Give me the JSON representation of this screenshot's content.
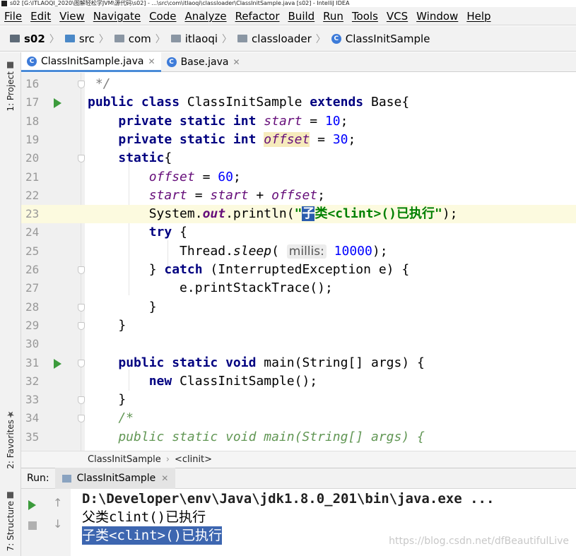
{
  "window": {
    "title": "s02 [G:\\ITLAOQI_2020\\图解轻松学JVM\\源代码\\s02] - ...\\src\\com\\itlaoqi\\classloader\\ClassInitSample.java [s02] - IntelliJ IDEA"
  },
  "menu": [
    "File",
    "Edit",
    "View",
    "Navigate",
    "Code",
    "Analyze",
    "Refactor",
    "Build",
    "Run",
    "Tools",
    "VCS",
    "Window",
    "Help"
  ],
  "breadcrumbs": [
    "s02",
    "src",
    "com",
    "itlaoqi",
    "classloader",
    "ClassInitSample"
  ],
  "left_tool_tabs": {
    "project": "1: Project",
    "favorites": "2: Favorites",
    "structure": "7: Structure"
  },
  "editor_tabs": [
    {
      "label": "ClassInitSample.java",
      "active": true
    },
    {
      "label": "Base.java",
      "active": false
    }
  ],
  "editor": {
    "lines": [
      {
        "n": "16",
        "code": " */"
      },
      {
        "n": "17",
        "code": "public class ClassInitSample extends Base{"
      },
      {
        "n": "18",
        "code": "    private static int start = 10;"
      },
      {
        "n": "19",
        "code": "    private static int offset = 30;"
      },
      {
        "n": "20",
        "code": "    static{"
      },
      {
        "n": "21",
        "code": "        offset = 60;"
      },
      {
        "n": "22",
        "code": "        start = start + offset;"
      },
      {
        "n": "23",
        "code": "        System.out.println(\"子类<clint>()已执行\");"
      },
      {
        "n": "24",
        "code": "        try {"
      },
      {
        "n": "25",
        "code": "            Thread.sleep( millis: 10000);"
      },
      {
        "n": "26",
        "code": "        } catch (InterruptedException e) {"
      },
      {
        "n": "27",
        "code": "            e.printStackTrace();"
      },
      {
        "n": "28",
        "code": "        }"
      },
      {
        "n": "29",
        "code": "    }"
      },
      {
        "n": "30",
        "code": ""
      },
      {
        "n": "31",
        "code": "    public static void main(String[] args) {"
      },
      {
        "n": "32",
        "code": "        new ClassInitSample();"
      },
      {
        "n": "33",
        "code": "    }"
      },
      {
        "n": "34",
        "code": "    /*"
      },
      {
        "n": "35",
        "code": "    public static void main(String[] args) {"
      }
    ],
    "inlay_hint": "millis:",
    "crumb": [
      "ClassInitSample",
      "<clinit>"
    ]
  },
  "run_panel": {
    "label": "Run:",
    "tab": "ClassInitSample",
    "output": [
      "D:\\Developer\\env\\Java\\jdk1.8.0_201\\bin\\java.exe ...",
      "父类clint()已执行",
      "子类<clint>()已执行"
    ]
  },
  "watermark": "https://blog.csdn.net/dfBeautifulLive",
  "colors": {
    "keyword": "#000080",
    "field": "#660e7a",
    "number": "#0000ff",
    "string": "#008000",
    "selection": "#2a5cad",
    "run_icon": "#3c9b3c"
  }
}
